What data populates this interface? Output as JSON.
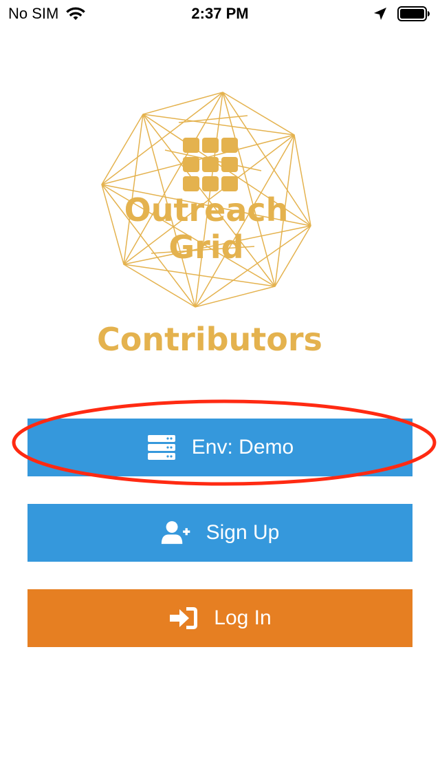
{
  "status_bar": {
    "carrier": "No SIM",
    "time": "2:37 PM",
    "icons": [
      "wifi-icon",
      "location-arrow-icon",
      "battery-icon"
    ]
  },
  "logo": {
    "title": "Outreach Grid",
    "subtitle": "Contributors",
    "color": "#e4b24e"
  },
  "buttons": {
    "env": {
      "label": "Env: Demo",
      "icon": "server-icon",
      "color": "#3598dc"
    },
    "signup": {
      "label": "Sign Up",
      "icon": "user-plus-icon",
      "color": "#3598dc"
    },
    "login": {
      "label": "Log In",
      "icon": "sign-in-icon",
      "color": "#e67f22"
    }
  },
  "annotation": {
    "color": "#ff2a12"
  }
}
